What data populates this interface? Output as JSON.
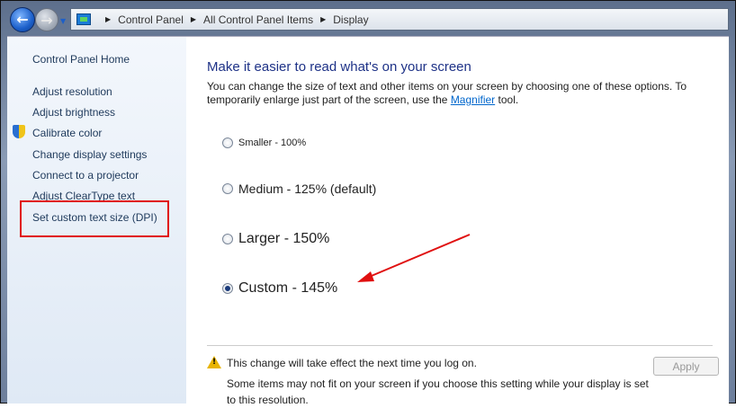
{
  "breadcrumb": [
    "Control Panel",
    "All Control Panel Items",
    "Display"
  ],
  "sidebar": {
    "home": "Control Panel Home",
    "items": [
      "Adjust resolution",
      "Adjust brightness",
      "Calibrate color",
      "Change display settings",
      "Connect to a projector",
      "Adjust ClearType text",
      "Set custom text size (DPI)"
    ]
  },
  "main": {
    "title": "Make it easier to read what's on your screen",
    "desc_before": "You can change the size of text and other items on your screen by choosing one of these options. To temporarily enlarge just part of the screen, use the ",
    "desc_link": "Magnifier",
    "desc_after": " tool.",
    "options": [
      {
        "label": "Smaller - 100%",
        "selected": false
      },
      {
        "label": "Medium - 125% (default)",
        "selected": false
      },
      {
        "label": "Larger - 150%",
        "selected": false
      },
      {
        "label": "Custom - 145%",
        "selected": true
      }
    ],
    "warning": "This change will take effect the next time you log on.",
    "note": "Some items may not fit on your screen if you choose this setting while your display is set to this resolution.",
    "apply": "Apply"
  },
  "colors": {
    "highlight": "#e01010",
    "title": "#1e3287"
  }
}
